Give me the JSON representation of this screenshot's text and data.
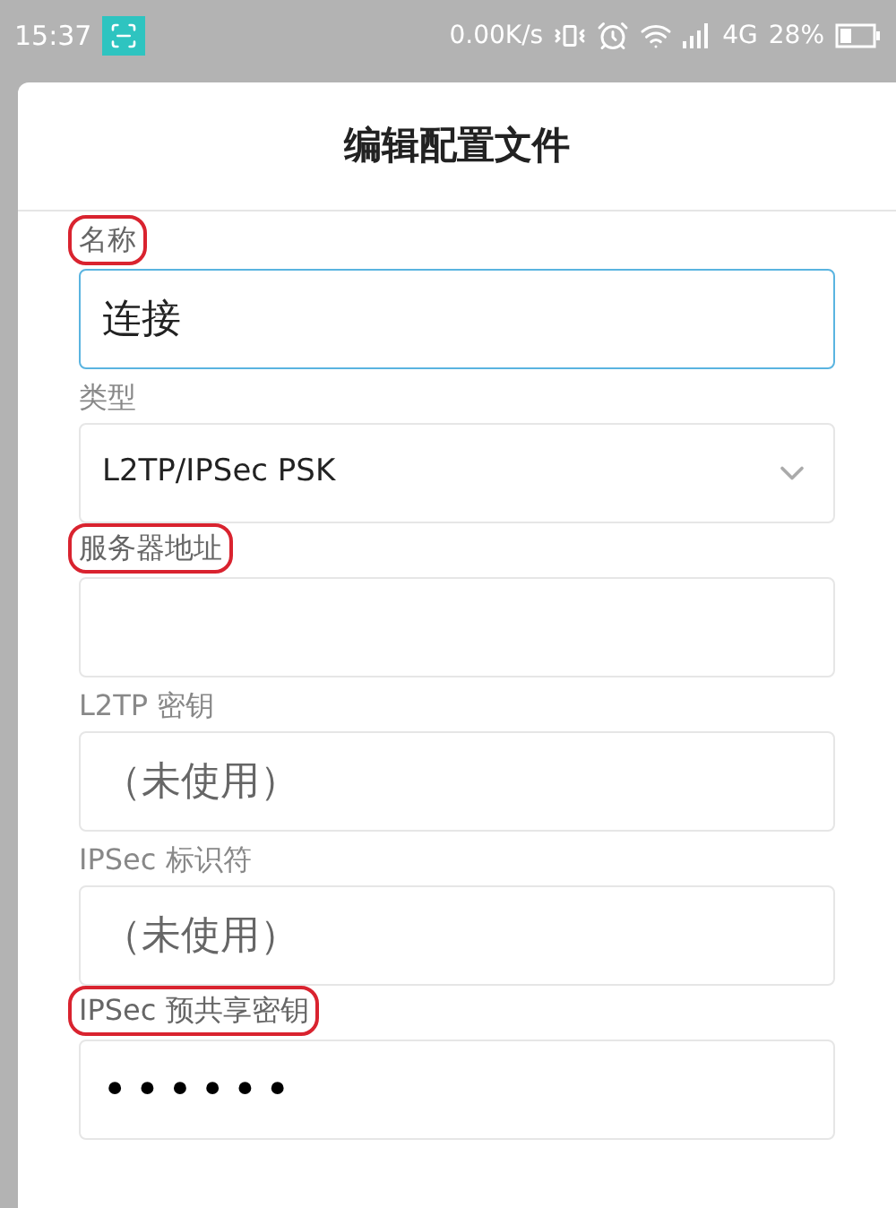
{
  "status_bar": {
    "time": "15:37",
    "speed": "0.00K/s",
    "network": "4G",
    "battery_percent": "28%"
  },
  "dialog": {
    "title": "编辑配置文件"
  },
  "fields": [
    {
      "label": "名称",
      "circled": true,
      "kind": "text",
      "value": "连接",
      "focused": true
    },
    {
      "label": "类型",
      "circled": false,
      "kind": "select",
      "value": "L2TP/IPSec PSK",
      "focused": false
    },
    {
      "label": "服务器地址",
      "circled": true,
      "kind": "text",
      "focused": false
    },
    {
      "label": "L2TP 密钥",
      "circled": false,
      "kind": "text",
      "placeholder": "（未使用）",
      "focused": false
    },
    {
      "label": "IPSec 标识符",
      "circled": false,
      "kind": "text",
      "placeholder": "（未使用）",
      "focused": false
    },
    {
      "label": "IPSec 预共享密钥",
      "circled": true,
      "kind": "password",
      "value": "••••••",
      "focused": false
    }
  ]
}
